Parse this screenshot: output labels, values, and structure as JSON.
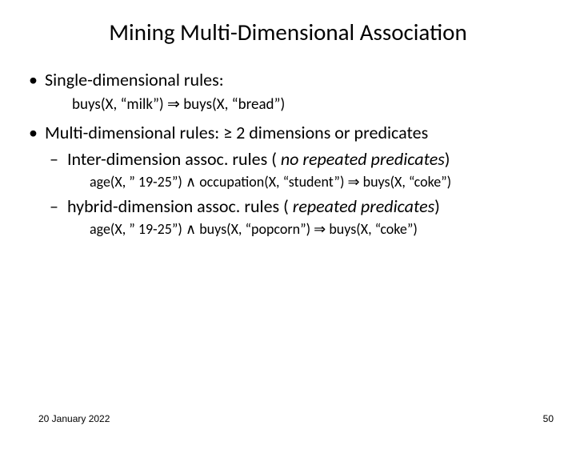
{
  "title": "Mining Multi-Dimensional Association",
  "symbols": {
    "implies": " ⇒ ",
    "and": " ∧ ",
    "geq": " ≥ ",
    "close_paren": ")"
  },
  "bullets": [
    {
      "text": "Single-dimensional rules:",
      "rule": {
        "lhs": "buys(X, “milk”) ",
        "rhs": " buys(X, “bread”)"
      }
    },
    {
      "text_a": "Multi-dimensional rules:",
      "text_b": "2 dimensions or predicates",
      "sub": [
        {
          "text": "Inter-dimension assoc. rules (",
          "italic": "no repeated predicates",
          "rule": {
            "p1": "age(X, ” 19-25”) ",
            "p2": " occupation(X, “student”) ",
            "p3": " buys(X, “coke”)"
          }
        },
        {
          "text": "hybrid-dimension assoc. rules (",
          "italic": "repeated predicates",
          "rule": {
            "p1": "age(X, ” 19-25”) ",
            "p2": "  buys(X, “popcorn”) ",
            "p3": " buys(X, “coke”)"
          }
        }
      ]
    }
  ],
  "footer": {
    "date": "20 January 2022",
    "page": "50"
  }
}
